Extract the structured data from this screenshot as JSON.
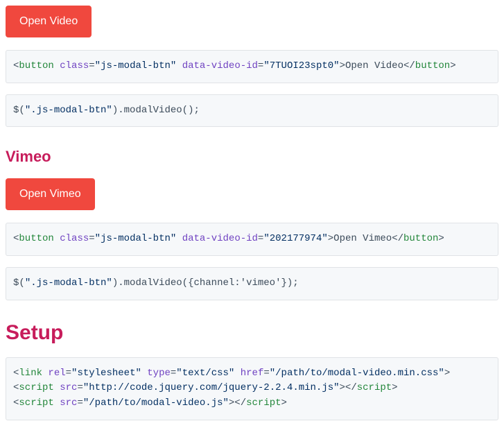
{
  "section_youtube": {
    "button_label": "Open Video",
    "code_html": {
      "tag": "button",
      "attr_class_name": "class",
      "attr_class_val": "js-modal-btn",
      "attr_vid_name": "data-video-id",
      "attr_vid_val": "7TUOI23spt0",
      "inner": "Open Video"
    },
    "code_js": {
      "selector": "\".js-modal-btn\"",
      "tail": ".modalVideo();"
    }
  },
  "section_vimeo": {
    "heading": "Vimeo",
    "button_label": "Open Vimeo",
    "code_html": {
      "tag": "button",
      "attr_class_name": "class",
      "attr_class_val": "js-modal-btn",
      "attr_vid_name": "data-video-id",
      "attr_vid_val": "202177974",
      "inner": "Open Vimeo"
    },
    "code_js": {
      "selector": "\".js-modal-btn\"",
      "tail": ".modalVideo({channel:'vimeo'});"
    }
  },
  "section_setup": {
    "heading": "Setup",
    "lines": {
      "l1": {
        "tag": "link",
        "a1n": "rel",
        "a1v": "stylesheet",
        "a2n": "type",
        "a2v": "text/css",
        "a3n": "href",
        "a3v": "/path/to/modal-video.min.css"
      },
      "l2": {
        "tag": "script",
        "a1n": "src",
        "a1v": "http://code.jquery.com/jquery-2.2.4.min.js"
      },
      "l3": {
        "tag": "script",
        "a1n": "src",
        "a1v": "/path/to/modal-video.js"
      }
    }
  }
}
